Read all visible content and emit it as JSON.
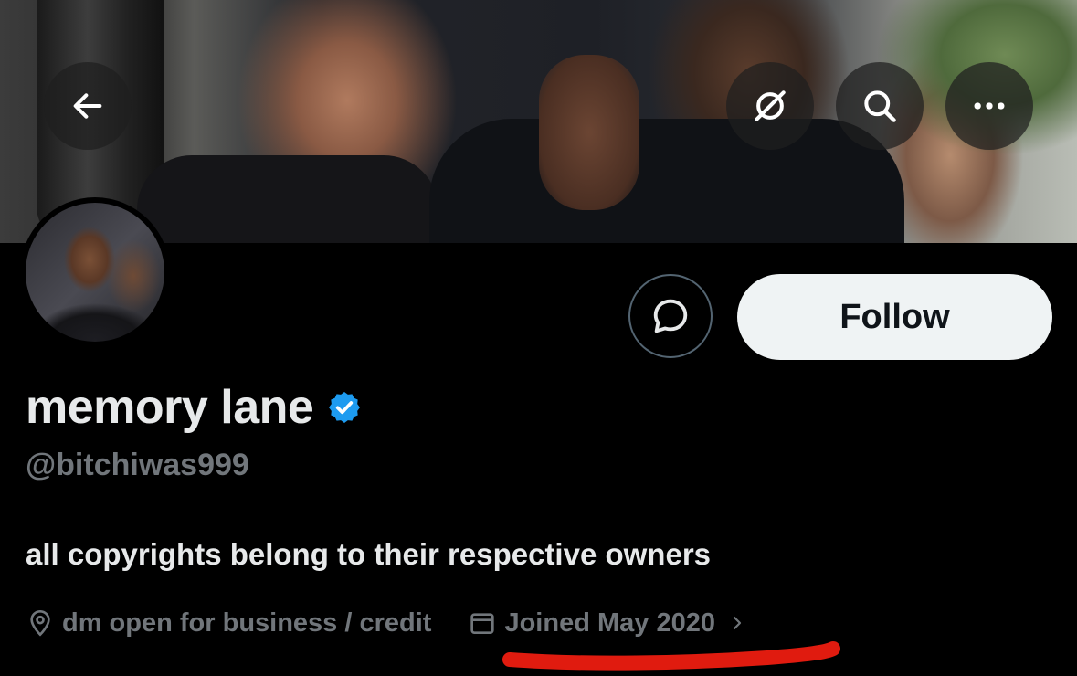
{
  "header": {
    "back_icon": "arrow-left-icon",
    "grok_icon": "grok-slash-icon",
    "search_icon": "search-icon",
    "more_icon": "more-horizontal-icon"
  },
  "profile": {
    "display_name": "memory lane",
    "verified": true,
    "handle": "@bitchiwas999",
    "bio": "all copyrights belong to their respective owners",
    "location": "dm open for business / credit",
    "joined": "Joined May 2020"
  },
  "actions": {
    "message_icon": "message-bubble-icon",
    "follow_label": "Follow"
  },
  "colors": {
    "verified_blue": "#1d9bf0",
    "annotation_red": "#e01b0f",
    "muted_text": "#71767b"
  }
}
